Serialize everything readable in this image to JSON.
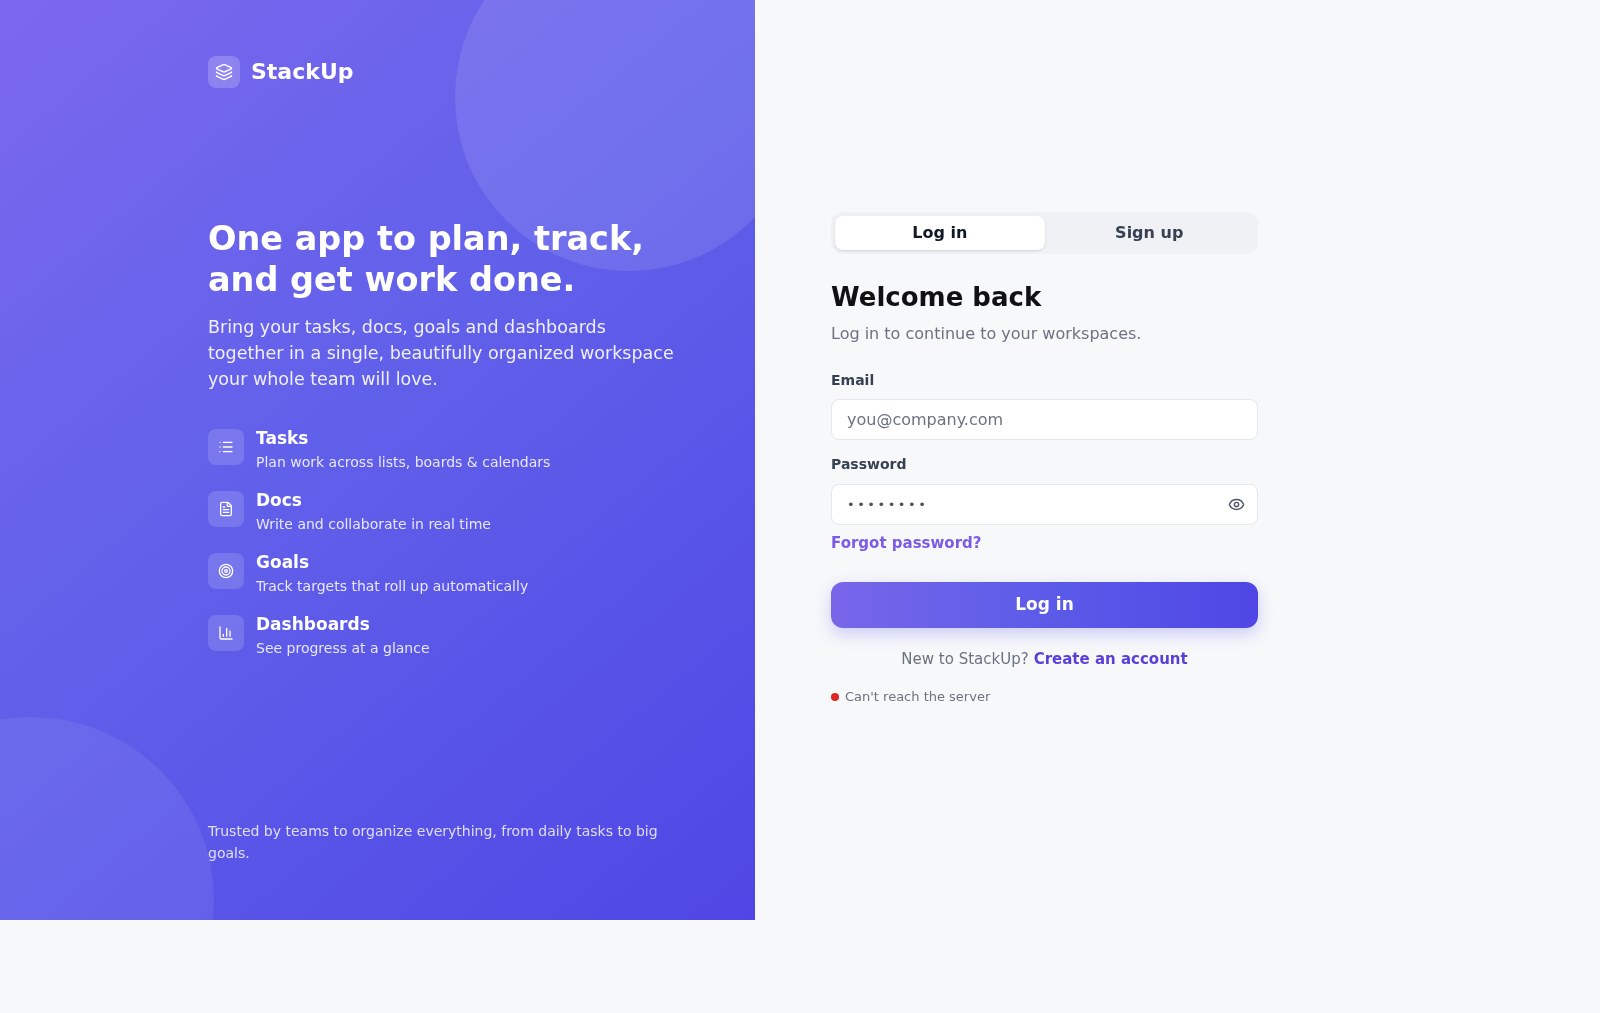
{
  "brand": {
    "name": "StackUp"
  },
  "hero": {
    "headline": "One app to plan, track, and get work done.",
    "description": "Bring your tasks, docs, goals and dashboards together in a single, beautifully organized workspace your whole team will love."
  },
  "features": [
    {
      "title": "Tasks",
      "description": "Plan work across lists, boards & calendars"
    },
    {
      "title": "Docs",
      "description": "Write and collaborate in real time"
    },
    {
      "title": "Goals",
      "description": "Track targets that roll up automatically"
    },
    {
      "title": "Dashboards",
      "description": "See progress at a glance"
    }
  ],
  "footer": "Trusted by teams to organize everything, from daily tasks to big goals.",
  "auth_tabs": [
    {
      "label": "Log in",
      "selected": true
    },
    {
      "label": "Sign up",
      "selected": false
    }
  ],
  "form": {
    "title": "Welcome back",
    "subtitle": "Log in to continue to your workspaces.",
    "fields": [
      {
        "kind": "email",
        "label": "Email",
        "placeholder": "you@company.com"
      },
      {
        "kind": "password",
        "label": "Password",
        "value": "••••••••"
      }
    ],
    "forgot_link": "Forgot password?",
    "submit": "Log in",
    "signup_prompt": {
      "text": "New to StackUp?",
      "link": "Create an account"
    }
  },
  "status": {
    "text": "Can't reach the server",
    "color": "#dc2626"
  }
}
